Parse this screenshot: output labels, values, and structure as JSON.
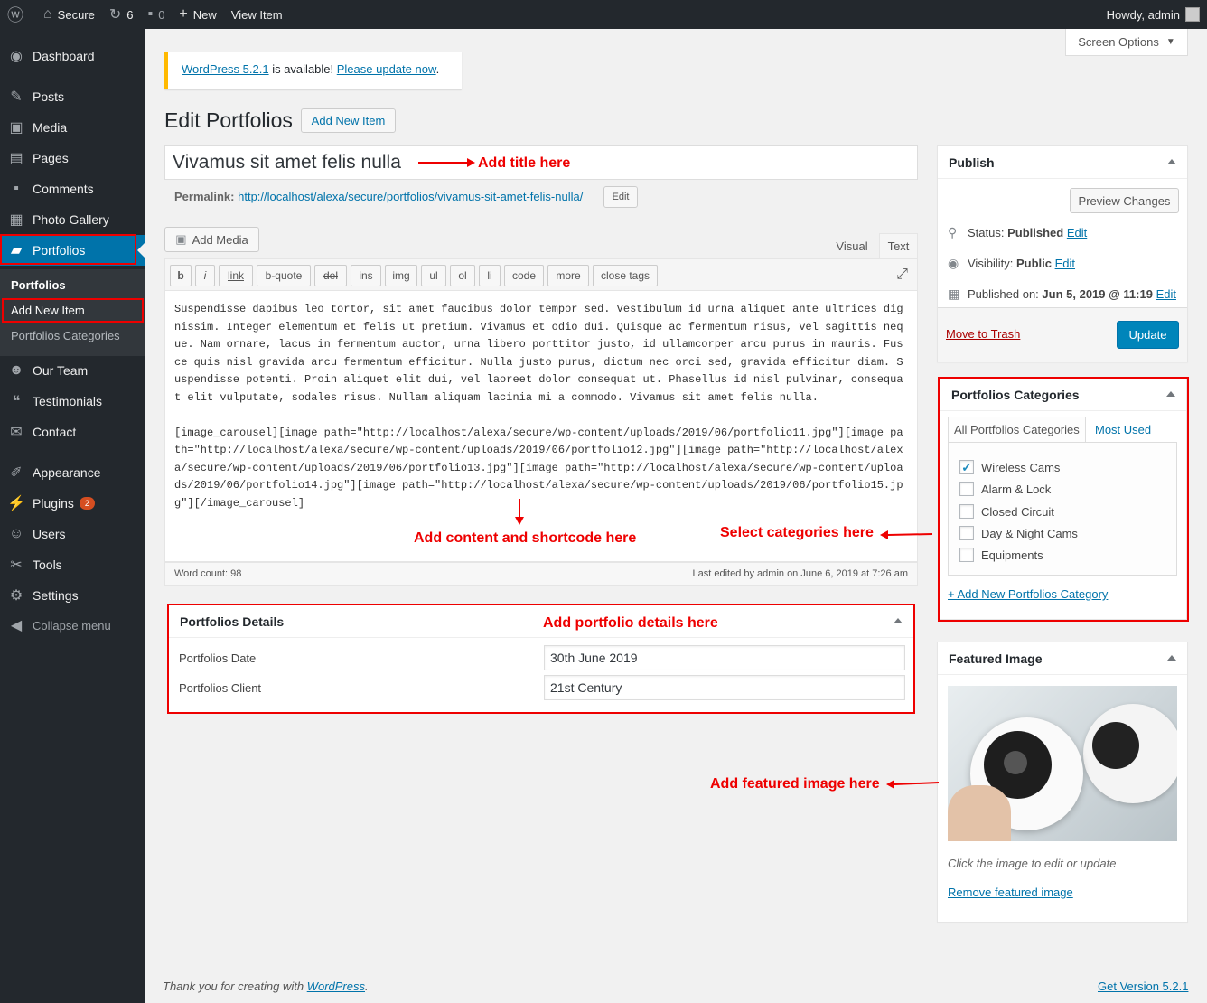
{
  "adminbar": {
    "site_name": "Secure",
    "updates_count": "6",
    "comments_count": "0",
    "new_label": "New",
    "view_item_label": "View Item",
    "howdy": "Howdy, admin"
  },
  "sidebar": {
    "items": [
      {
        "label": "Dashboard",
        "icon": "dashboard-icon"
      },
      {
        "label": "Posts",
        "icon": "pin-icon"
      },
      {
        "label": "Media",
        "icon": "media-icon"
      },
      {
        "label": "Pages",
        "icon": "pages-icon"
      },
      {
        "label": "Comments",
        "icon": "comment-icon"
      },
      {
        "label": "Photo Gallery",
        "icon": "gallery-icon"
      },
      {
        "label": "Portfolios",
        "icon": "folder-icon"
      },
      {
        "label": "Our Team",
        "icon": "team-icon"
      },
      {
        "label": "Testimonials",
        "icon": "quote-icon"
      },
      {
        "label": "Contact",
        "icon": "mail-icon"
      },
      {
        "label": "Appearance",
        "icon": "brush-icon"
      },
      {
        "label": "Plugins",
        "icon": "plugin-icon",
        "badge": "2"
      },
      {
        "label": "Users",
        "icon": "user-icon"
      },
      {
        "label": "Tools",
        "icon": "wrench-icon"
      },
      {
        "label": "Settings",
        "icon": "settings-icon"
      },
      {
        "label": "Collapse menu",
        "icon": "collapse-icon"
      }
    ],
    "submenu": [
      "Portfolios",
      "Add New Item",
      "Portfolios Categories"
    ]
  },
  "screen_options": "Screen Options",
  "notice": {
    "version_link": "WordPress 5.2.1",
    "middle": " is available! ",
    "update_link": "Please update now",
    "end": "."
  },
  "page": {
    "title": "Edit Portfolios",
    "add_new": "Add New Item",
    "post_title": "Vivamus sit amet felis nulla",
    "permalink_label": "Permalink:",
    "permalink_url": "http://localhost/alexa/secure/portfolios/vivamus-sit-amet-felis-nulla/",
    "permalink_edit": "Edit"
  },
  "editor": {
    "add_media": "Add Media",
    "tab_visual": "Visual",
    "tab_text": "Text",
    "quicktags": [
      "b",
      "i",
      "link",
      "b-quote",
      "del",
      "ins",
      "img",
      "ul",
      "ol",
      "li",
      "code",
      "more",
      "close tags"
    ],
    "content": "Suspendisse dapibus leo tortor, sit amet faucibus dolor tempor sed. Vestibulum id urna aliquet ante ultrices dignissim. Integer elementum et felis ut pretium. Vivamus et odio dui. Quisque ac fermentum risus, vel sagittis neque. Nam ornare, lacus in fermentum auctor, urna libero porttitor justo, id ullamcorper arcu purus in mauris. Fusce quis nisl gravida arcu fermentum efficitur. Nulla justo purus, dictum nec orci sed, gravida efficitur diam. Suspendisse potenti. Proin aliquet elit dui, vel laoreet dolor consequat ut. Phasellus id nisl pulvinar, consequat elit vulputate, sodales risus. Nullam aliquam lacinia mi a commodo. Vivamus sit amet felis nulla.\n\n[image_carousel][image path=\"http://localhost/alexa/secure/wp-content/uploads/2019/06/portfolio11.jpg\"][image path=\"http://localhost/alexa/secure/wp-content/uploads/2019/06/portfolio12.jpg\"][image path=\"http://localhost/alexa/secure/wp-content/uploads/2019/06/portfolio13.jpg\"][image path=\"http://localhost/alexa/secure/wp-content/uploads/2019/06/portfolio14.jpg\"][image path=\"http://localhost/alexa/secure/wp-content/uploads/2019/06/portfolio15.jpg\"][/image_carousel]",
    "word_count": "Word count: 98",
    "last_edited": "Last edited by admin on June 6, 2019 at 7:26 am"
  },
  "details": {
    "title": "Portfolios Details",
    "date_label": "Portfolios Date",
    "date_value": "30th June 2019",
    "client_label": "Portfolios Client",
    "client_value": "21st Century"
  },
  "publish": {
    "title": "Publish",
    "preview": "Preview Changes",
    "status_label": "Status:",
    "status_value": "Published",
    "visibility_label": "Visibility:",
    "visibility_value": "Public",
    "published_label": "Published on:",
    "published_value": "Jun 5, 2019 @ 11:19",
    "edit": "Edit",
    "trash": "Move to Trash",
    "update": "Update"
  },
  "categories": {
    "title": "Portfolios Categories",
    "tab_all": "All Portfolios Categories",
    "tab_most": "Most Used",
    "items": [
      {
        "label": "Wireless Cams",
        "checked": true
      },
      {
        "label": "Alarm & Lock",
        "checked": false
      },
      {
        "label": "Closed Circuit",
        "checked": false
      },
      {
        "label": "Day & Night Cams",
        "checked": false
      },
      {
        "label": "Equipments",
        "checked": false
      }
    ],
    "add_new": "+ Add New Portfolios Category"
  },
  "featured": {
    "title": "Featured Image",
    "caption": "Click the image to edit or update",
    "remove": "Remove featured image"
  },
  "annotations": {
    "title": "Add title here",
    "content": "Add content and shortcode here",
    "categories": "Select categories here",
    "details": "Add portfolio details here",
    "featured": "Add featured image here"
  },
  "footer": {
    "thanks": "Thank you for creating with ",
    "wp_link": "WordPress",
    "thanks_end": ".",
    "version": "Get Version 5.2.1"
  },
  "colors": {
    "accent": "#0073aa",
    "annotation": "#ee0000",
    "sidebar_bg": "#23282d",
    "notice_border": "#ffb900"
  }
}
